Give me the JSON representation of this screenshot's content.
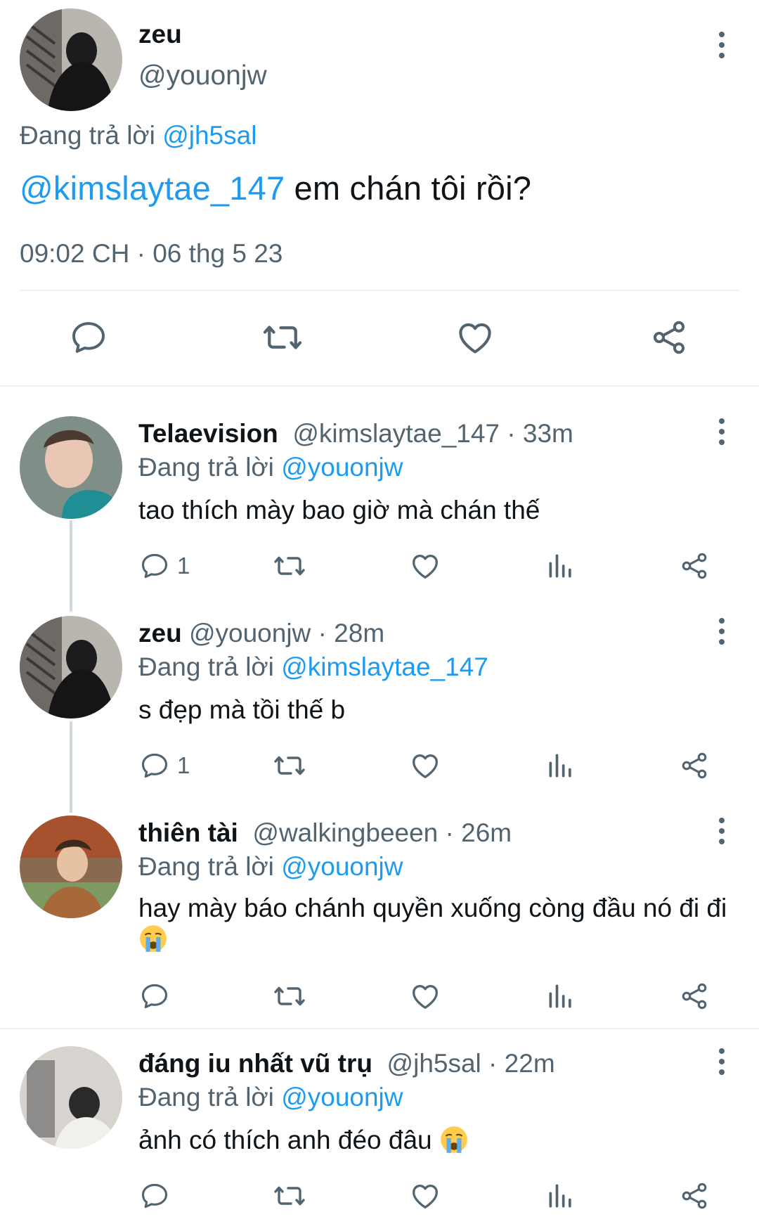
{
  "main_tweet": {
    "name": "zeu",
    "handle": "@youonjw",
    "replying_prefix": "Đang trả lời",
    "replying_to": "@jh5sal",
    "mention": "@kimslaytae_147",
    "text": " em chán tôi rồi?",
    "timestamp": "09:02 CH · 06 thg 5 23"
  },
  "replies": [
    {
      "name": "Telaevision",
      "handle_time": "@kimslaytae_147 · 33m",
      "replying_prefix": "Đang trả lời",
      "replying_to": "@youonjw",
      "text": "tao thích mày bao giờ mà chán thế",
      "reply_count": "1"
    },
    {
      "name": "zeu",
      "handle_time": "@youonjw · 28m",
      "replying_prefix": "Đang trả lời",
      "replying_to": "@kimslaytae_147",
      "text": "s đẹp mà tồi thế b",
      "reply_count": "1"
    },
    {
      "name": "thiên tài",
      "handle_time": "@walkingbeeen · 26m",
      "replying_prefix": "Đang trả lời",
      "replying_to": "@youonjw",
      "text": "hay mày báo chánh quyền xuống còng đầu nó đi đi",
      "reply_count": ""
    },
    {
      "name": "đáng iu nhất vũ trụ",
      "handle_time": "@jh5sal · 22m",
      "replying_prefix": "Đang trả lời",
      "replying_to": "@youonjw",
      "text": "ảnh có thích anh đéo đâu",
      "reply_count": ""
    }
  ],
  "icons": {
    "reply": "reply-bubble-icon",
    "retweet": "retweet-icon",
    "like": "heart-icon",
    "views": "analytics-bars-icon",
    "share": "share-icon",
    "more": "vertical-dots-icon",
    "emoji": "loudly-crying-face-emoji"
  },
  "colors": {
    "link": "#1d9bf0",
    "muted": "#536471",
    "text": "#0f1419",
    "divider": "#eff3f4"
  }
}
